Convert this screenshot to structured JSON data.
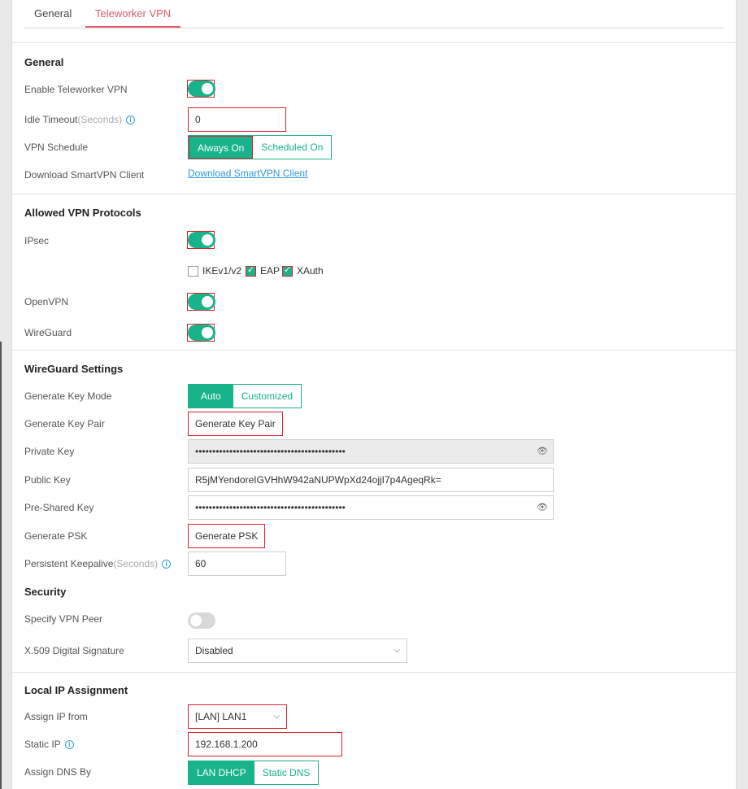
{
  "tabs": [
    {
      "label": "General"
    },
    {
      "label": "Teleworker VPN"
    }
  ],
  "general": {
    "title": "General",
    "enable_label": "Enable Teleworker VPN",
    "idle_label": "Idle Timeout",
    "idle_unit": "(Seconds)",
    "idle_value": "0",
    "schedule_label": "VPN Schedule",
    "schedule_options": [
      "Always On",
      "Scheduled On"
    ],
    "download_label": "Download SmartVPN Client",
    "download_link": "Download SmartVPN Client"
  },
  "protocols": {
    "title": "Allowed VPN Protocols",
    "ipsec_label": "IPsec",
    "ikev_label": "IKEv1/v2",
    "eap_label": "EAP",
    "xauth_label": "XAuth",
    "openvpn_label": "OpenVPN",
    "wireguard_label": "WireGuard"
  },
  "wireguard": {
    "title": "WireGuard Settings",
    "keymode_label": "Generate Key Mode",
    "keymode_options": [
      "Auto",
      "Customized"
    ],
    "keypair_label": "Generate Key Pair",
    "keypair_button": "Generate Key Pair",
    "private_label": "Private Key",
    "private_value": "••••••••••••••••••••••••••••••••••••••••••••",
    "public_label": "Public Key",
    "public_value": "R5jMYendoreIGVHhW942aNUPWpXd24ojjI7p4AgeqRk=",
    "psk_label": "Pre-Shared Key",
    "psk_value": "••••••••••••••••••••••••••••••••••••••••••••",
    "genpsk_label": "Generate PSK",
    "genpsk_button": "Generate PSK",
    "keepalive_label": "Persistent Keepalive",
    "keepalive_unit": "(Seconds)",
    "keepalive_value": "60"
  },
  "security": {
    "title": "Security",
    "peer_label": "Specify VPN Peer",
    "x509_label": "X.509 Digital Signature",
    "x509_value": "Disabled"
  },
  "local_ip": {
    "title": "Local IP Assignment",
    "assign_label": "Assign IP from",
    "assign_value": "[LAN] LAN1",
    "static_label": "Static IP",
    "static_value": "192.168.1.200",
    "dns_label": "Assign DNS By",
    "dns_options": [
      "LAN DHCP",
      "Static DNS"
    ]
  },
  "icons": {
    "info": "i",
    "eye": "👁",
    "chevron": "⌵",
    "check": "✓"
  },
  "colors": {
    "accent": "#18b38a",
    "tab_active": "#e05a6d",
    "highlight": "#d9232e",
    "link": "#2f9ad6"
  }
}
